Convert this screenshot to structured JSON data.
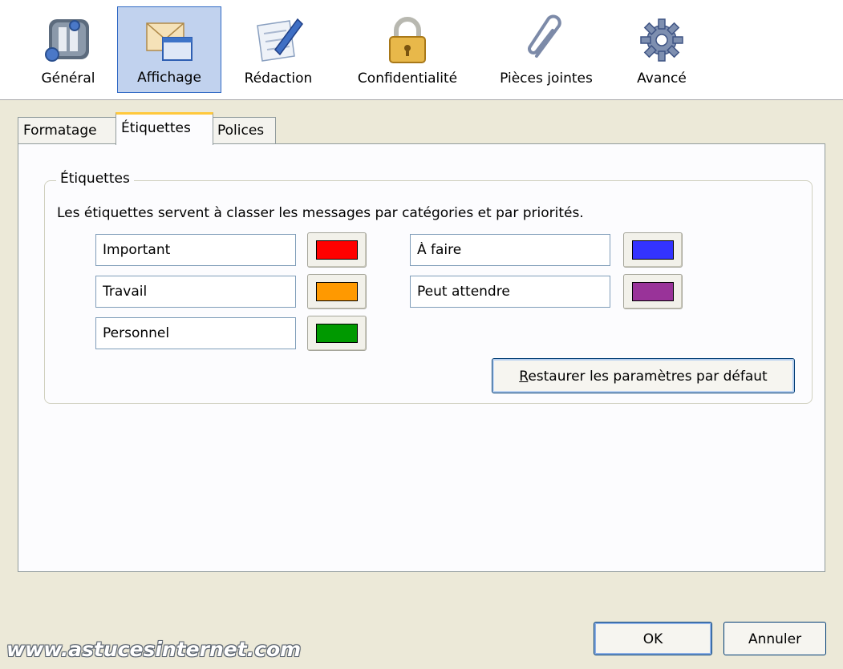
{
  "toolbar": {
    "panes": [
      {
        "label": "Général",
        "icon": "general-icon"
      },
      {
        "label": "Affichage",
        "icon": "display-envelope-icon"
      },
      {
        "label": "Rédaction",
        "icon": "compose-pen-icon"
      },
      {
        "label": "Confidentialité",
        "icon": "padlock-icon"
      },
      {
        "label": "Pièces jointes",
        "icon": "paperclip-icon"
      },
      {
        "label": "Avancé",
        "icon": "gear-icon"
      }
    ],
    "selected": "Affichage"
  },
  "tabs": [
    {
      "label": "Formatage"
    },
    {
      "label": "Étiquettes"
    },
    {
      "label": "Polices"
    }
  ],
  "active_tab": "Étiquettes",
  "group": {
    "title": "Étiquettes",
    "description": "Les étiquettes servent à classer les messages par catégories et par priorités.",
    "labels": [
      {
        "name": "Important",
        "color": "#ff0000"
      },
      {
        "name": "Travail",
        "color": "#ff9900"
      },
      {
        "name": "Personnel",
        "color": "#009900"
      },
      {
        "name": "À faire",
        "color": "#3333ff"
      },
      {
        "name": "Peut attendre",
        "color": "#993399"
      }
    ],
    "restore_first": "R",
    "restore_rest": "estaurer les paramètres par défaut"
  },
  "buttons": {
    "ok": "OK",
    "cancel": "Annuler"
  },
  "watermark": "www.astucesinternet.com"
}
